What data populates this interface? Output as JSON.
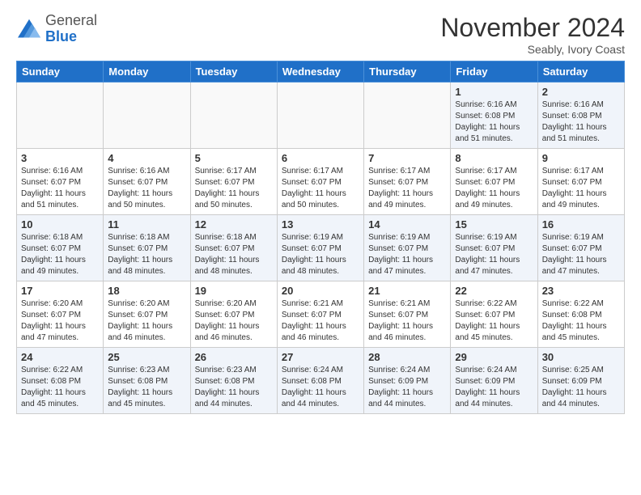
{
  "logo": {
    "general": "General",
    "blue": "Blue"
  },
  "header": {
    "month": "November 2024",
    "location": "Seably, Ivory Coast"
  },
  "weekdays": [
    "Sunday",
    "Monday",
    "Tuesday",
    "Wednesday",
    "Thursday",
    "Friday",
    "Saturday"
  ],
  "weeks": [
    [
      {
        "day": "",
        "sunrise": "",
        "sunset": "",
        "daylight": ""
      },
      {
        "day": "",
        "sunrise": "",
        "sunset": "",
        "daylight": ""
      },
      {
        "day": "",
        "sunrise": "",
        "sunset": "",
        "daylight": ""
      },
      {
        "day": "",
        "sunrise": "",
        "sunset": "",
        "daylight": ""
      },
      {
        "day": "",
        "sunrise": "",
        "sunset": "",
        "daylight": ""
      },
      {
        "day": "1",
        "sunrise": "Sunrise: 6:16 AM",
        "sunset": "Sunset: 6:08 PM",
        "daylight": "Daylight: 11 hours and 51 minutes."
      },
      {
        "day": "2",
        "sunrise": "Sunrise: 6:16 AM",
        "sunset": "Sunset: 6:08 PM",
        "daylight": "Daylight: 11 hours and 51 minutes."
      }
    ],
    [
      {
        "day": "3",
        "sunrise": "Sunrise: 6:16 AM",
        "sunset": "Sunset: 6:07 PM",
        "daylight": "Daylight: 11 hours and 51 minutes."
      },
      {
        "day": "4",
        "sunrise": "Sunrise: 6:16 AM",
        "sunset": "Sunset: 6:07 PM",
        "daylight": "Daylight: 11 hours and 50 minutes."
      },
      {
        "day": "5",
        "sunrise": "Sunrise: 6:17 AM",
        "sunset": "Sunset: 6:07 PM",
        "daylight": "Daylight: 11 hours and 50 minutes."
      },
      {
        "day": "6",
        "sunrise": "Sunrise: 6:17 AM",
        "sunset": "Sunset: 6:07 PM",
        "daylight": "Daylight: 11 hours and 50 minutes."
      },
      {
        "day": "7",
        "sunrise": "Sunrise: 6:17 AM",
        "sunset": "Sunset: 6:07 PM",
        "daylight": "Daylight: 11 hours and 49 minutes."
      },
      {
        "day": "8",
        "sunrise": "Sunrise: 6:17 AM",
        "sunset": "Sunset: 6:07 PM",
        "daylight": "Daylight: 11 hours and 49 minutes."
      },
      {
        "day": "9",
        "sunrise": "Sunrise: 6:17 AM",
        "sunset": "Sunset: 6:07 PM",
        "daylight": "Daylight: 11 hours and 49 minutes."
      }
    ],
    [
      {
        "day": "10",
        "sunrise": "Sunrise: 6:18 AM",
        "sunset": "Sunset: 6:07 PM",
        "daylight": "Daylight: 11 hours and 49 minutes."
      },
      {
        "day": "11",
        "sunrise": "Sunrise: 6:18 AM",
        "sunset": "Sunset: 6:07 PM",
        "daylight": "Daylight: 11 hours and 48 minutes."
      },
      {
        "day": "12",
        "sunrise": "Sunrise: 6:18 AM",
        "sunset": "Sunset: 6:07 PM",
        "daylight": "Daylight: 11 hours and 48 minutes."
      },
      {
        "day": "13",
        "sunrise": "Sunrise: 6:19 AM",
        "sunset": "Sunset: 6:07 PM",
        "daylight": "Daylight: 11 hours and 48 minutes."
      },
      {
        "day": "14",
        "sunrise": "Sunrise: 6:19 AM",
        "sunset": "Sunset: 6:07 PM",
        "daylight": "Daylight: 11 hours and 47 minutes."
      },
      {
        "day": "15",
        "sunrise": "Sunrise: 6:19 AM",
        "sunset": "Sunset: 6:07 PM",
        "daylight": "Daylight: 11 hours and 47 minutes."
      },
      {
        "day": "16",
        "sunrise": "Sunrise: 6:19 AM",
        "sunset": "Sunset: 6:07 PM",
        "daylight": "Daylight: 11 hours and 47 minutes."
      }
    ],
    [
      {
        "day": "17",
        "sunrise": "Sunrise: 6:20 AM",
        "sunset": "Sunset: 6:07 PM",
        "daylight": "Daylight: 11 hours and 47 minutes."
      },
      {
        "day": "18",
        "sunrise": "Sunrise: 6:20 AM",
        "sunset": "Sunset: 6:07 PM",
        "daylight": "Daylight: 11 hours and 46 minutes."
      },
      {
        "day": "19",
        "sunrise": "Sunrise: 6:20 AM",
        "sunset": "Sunset: 6:07 PM",
        "daylight": "Daylight: 11 hours and 46 minutes."
      },
      {
        "day": "20",
        "sunrise": "Sunrise: 6:21 AM",
        "sunset": "Sunset: 6:07 PM",
        "daylight": "Daylight: 11 hours and 46 minutes."
      },
      {
        "day": "21",
        "sunrise": "Sunrise: 6:21 AM",
        "sunset": "Sunset: 6:07 PM",
        "daylight": "Daylight: 11 hours and 46 minutes."
      },
      {
        "day": "22",
        "sunrise": "Sunrise: 6:22 AM",
        "sunset": "Sunset: 6:07 PM",
        "daylight": "Daylight: 11 hours and 45 minutes."
      },
      {
        "day": "23",
        "sunrise": "Sunrise: 6:22 AM",
        "sunset": "Sunset: 6:08 PM",
        "daylight": "Daylight: 11 hours and 45 minutes."
      }
    ],
    [
      {
        "day": "24",
        "sunrise": "Sunrise: 6:22 AM",
        "sunset": "Sunset: 6:08 PM",
        "daylight": "Daylight: 11 hours and 45 minutes."
      },
      {
        "day": "25",
        "sunrise": "Sunrise: 6:23 AM",
        "sunset": "Sunset: 6:08 PM",
        "daylight": "Daylight: 11 hours and 45 minutes."
      },
      {
        "day": "26",
        "sunrise": "Sunrise: 6:23 AM",
        "sunset": "Sunset: 6:08 PM",
        "daylight": "Daylight: 11 hours and 44 minutes."
      },
      {
        "day": "27",
        "sunrise": "Sunrise: 6:24 AM",
        "sunset": "Sunset: 6:08 PM",
        "daylight": "Daylight: 11 hours and 44 minutes."
      },
      {
        "day": "28",
        "sunrise": "Sunrise: 6:24 AM",
        "sunset": "Sunset: 6:09 PM",
        "daylight": "Daylight: 11 hours and 44 minutes."
      },
      {
        "day": "29",
        "sunrise": "Sunrise: 6:24 AM",
        "sunset": "Sunset: 6:09 PM",
        "daylight": "Daylight: 11 hours and 44 minutes."
      },
      {
        "day": "30",
        "sunrise": "Sunrise: 6:25 AM",
        "sunset": "Sunset: 6:09 PM",
        "daylight": "Daylight: 11 hours and 44 minutes."
      }
    ]
  ]
}
